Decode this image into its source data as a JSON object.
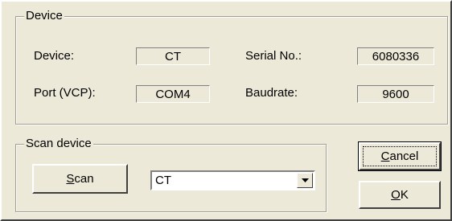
{
  "device_group": {
    "title": "Device",
    "device_label": "Device:",
    "device_value": "CT",
    "serial_label": "Serial No.:",
    "serial_value": "6080336",
    "port_label": "Port (VCP):",
    "port_value": "COM4",
    "baud_label": "Baudrate:",
    "baud_value": "9600"
  },
  "scan_group": {
    "title": "Scan device",
    "scan_button": {
      "mnemonic": "S",
      "rest": "can"
    },
    "device_select": {
      "selected": "CT"
    }
  },
  "buttons": {
    "cancel": {
      "mnemonic": "C",
      "rest": "ancel"
    },
    "ok": {
      "mnemonic": "O",
      "rest": "K"
    }
  }
}
